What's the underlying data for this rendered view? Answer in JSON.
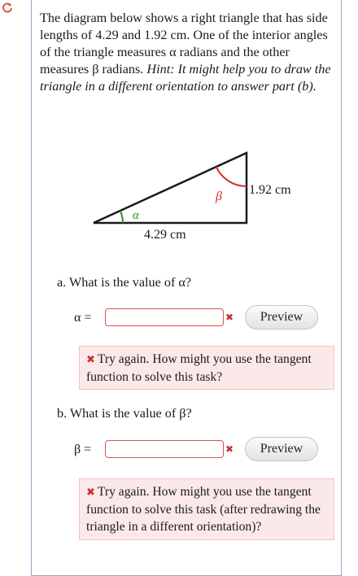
{
  "problem": {
    "intro": "The diagram below shows a right triangle that has side lengths of 4.29 and 1.92 cm. One of the interior angles of the triangle measures α radians and the other measures β radians.",
    "hint": "Hint: It might help you to draw the triangle in a different orientation to answer part (b)."
  },
  "diagram": {
    "side_vertical": "1.92 cm",
    "side_horizontal": "4.29 cm",
    "angle_alpha": "α",
    "angle_beta": "β",
    "colors": {
      "alpha": "#2e8b2e",
      "beta": "#d32f2f"
    }
  },
  "part_a": {
    "question": "a. What is the value of α?",
    "lhs": "α =",
    "value": "",
    "preview": "Preview",
    "feedback": "Try again. How might you use the tangent function to solve this task?"
  },
  "part_b": {
    "question": "b. What is the value of β?",
    "lhs": "β =",
    "value": "",
    "preview": "Preview",
    "feedback": "Try again. How might you use the tangent function to solve this task (after redrawing the triangle in a different orientation)?"
  },
  "icons": {
    "reload": "reload-icon",
    "error": "x-icon"
  }
}
